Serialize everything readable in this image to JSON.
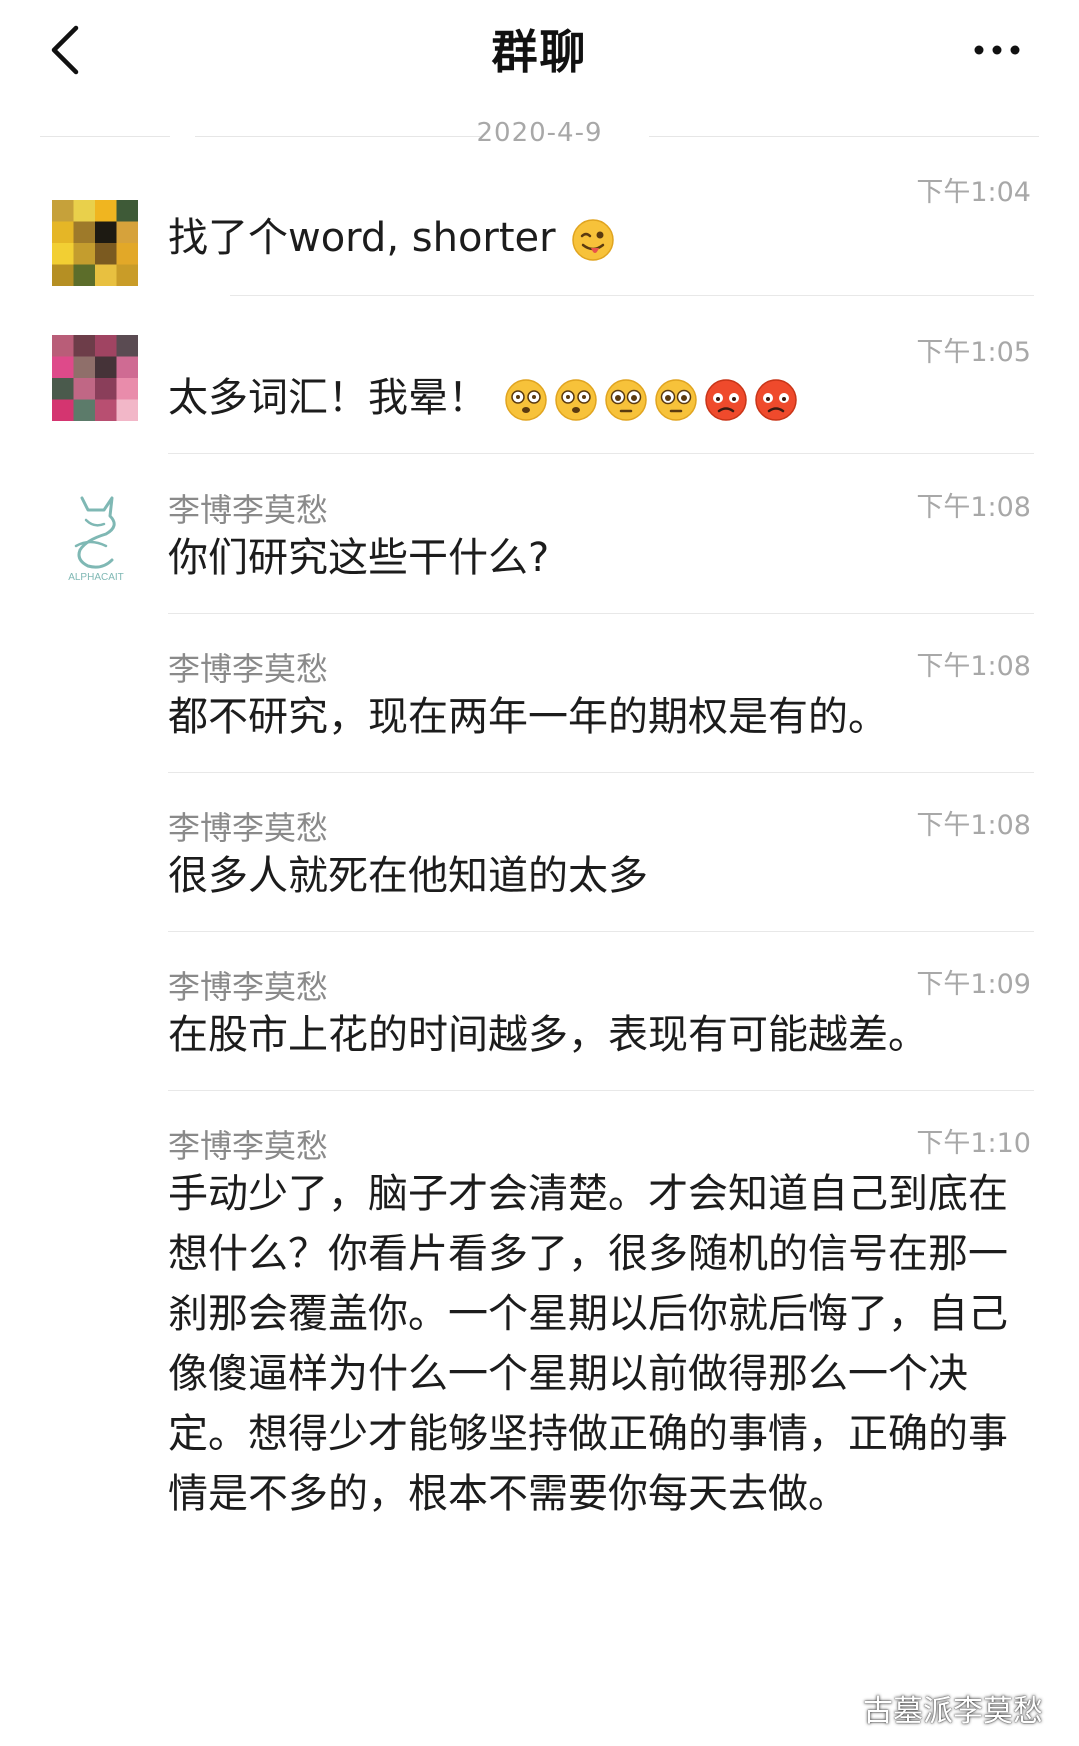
{
  "header": {
    "title": "群聊",
    "back_icon": "chevron-left-icon",
    "more_icon": "more-dots-icon"
  },
  "date_separator": "2020-4-9",
  "messages": [
    {
      "sender": "",
      "time": "下午1:04",
      "text": "找了个word, shorter",
      "emojis": [
        "wink-tongue"
      ]
    },
    {
      "sender": "",
      "time": "下午1:05",
      "text": "太多词汇！我晕！",
      "emojis": [
        "dizzy",
        "dizzy",
        "flushed",
        "flushed",
        "angry",
        "angry"
      ]
    },
    {
      "sender": "李博李莫愁",
      "time": "下午1:08",
      "text": "你们研究这些干什么?"
    },
    {
      "sender": "李博李莫愁",
      "time": "下午1:08",
      "text": "都不研究，现在两年一年的期权是有的。"
    },
    {
      "sender": "李博李莫愁",
      "time": "下午1:08",
      "text": "很多人就死在他知道的太多"
    },
    {
      "sender": "李博李莫愁",
      "time": "下午1:09",
      "text": "在股市上花的时间越多，表现有可能越差。"
    },
    {
      "sender": "李博李莫愁",
      "time": "下午1:10",
      "text": "手动少了，脑子才会清楚。才会知道自己到底在想什么？你看片看多了，很多随机的信号在那一刹那会覆盖你。一个星期以后你就后悔了，自己像傻逼样为什么一个星期以前做得那么一个决定。想得少才能够坚持做正确的事情，正确的事情是不多的，根本不需要你每天去做。"
    }
  ],
  "avatar_logo_text": "ALPHACAIT",
  "watermark": "古墓派李莫愁",
  "colors": {
    "background": "#ffffff",
    "sender": "#8a8a8a",
    "time": "#a8a8a8",
    "divider": "#e8e8e8"
  }
}
